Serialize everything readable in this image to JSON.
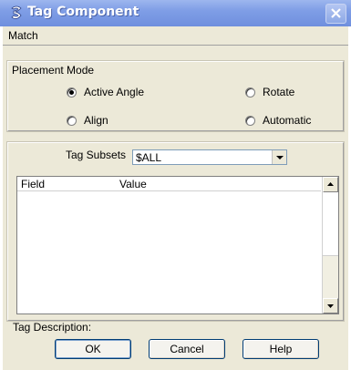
{
  "window": {
    "title": "Tag Component"
  },
  "menu": {
    "items": [
      "Match"
    ]
  },
  "placement_mode": {
    "label": "Placement Mode",
    "options": {
      "active_angle": {
        "label": "Active Angle",
        "selected": true
      },
      "rotate": {
        "label": "Rotate",
        "selected": false
      },
      "align": {
        "label": "Align",
        "selected": false
      },
      "automatic": {
        "label": "Automatic",
        "selected": false
      }
    }
  },
  "tag_subsets": {
    "label": "Tag Subsets",
    "value": "$ALL"
  },
  "table": {
    "columns": [
      "Field",
      "Value"
    ],
    "rows": []
  },
  "tag_description": {
    "label": "Tag Description:"
  },
  "buttons": {
    "ok": "OK",
    "cancel": "Cancel",
    "help": "Help"
  },
  "colors": {
    "title_bar": "#7f9ee6",
    "dialog_background": "#ece9d8"
  },
  "icons": {
    "app": "microstation-icon",
    "close": "close-icon",
    "combo_arrow": "chevron-down-icon"
  }
}
